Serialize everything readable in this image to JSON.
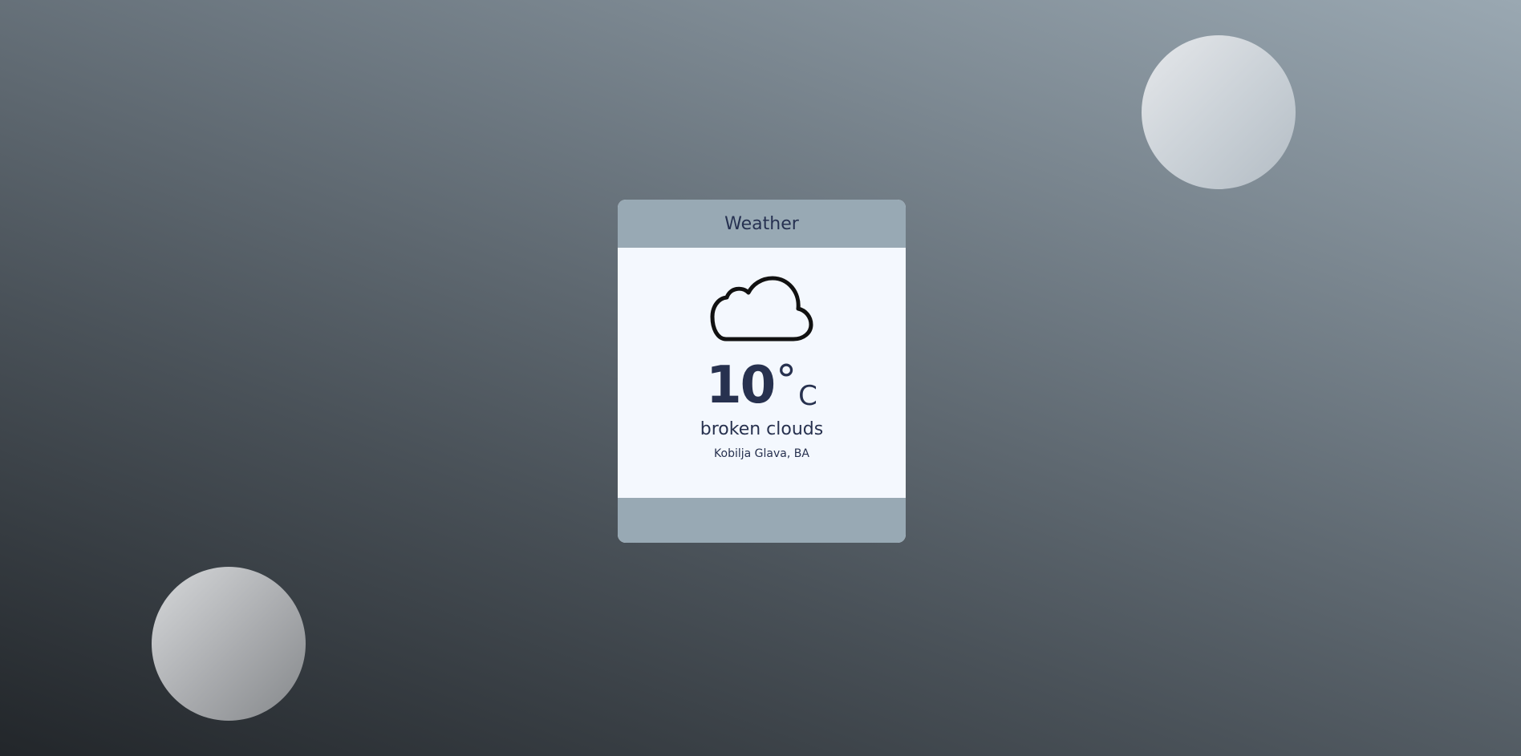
{
  "widget": {
    "title": "Weather",
    "icon": "cloud-icon",
    "temperature": "10",
    "degree_symbol": "°",
    "unit": "C",
    "condition": "broken clouds",
    "location": "Kobilja Glava, BA"
  },
  "colors": {
    "header_footer": "#98a9b4",
    "card_body": "#f4f8fe",
    "text": "#27314f"
  }
}
